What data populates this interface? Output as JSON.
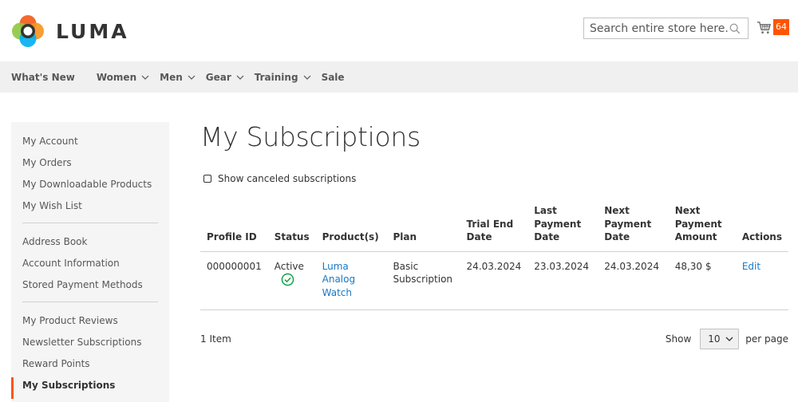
{
  "brand": {
    "name": "LUMA",
    "colors": {
      "accent": "#ff5501",
      "link": "#1979c3",
      "nav_bg": "#f0f0f0"
    }
  },
  "search": {
    "placeholder": "Search entire store here..."
  },
  "cart": {
    "count": "64"
  },
  "nav": {
    "items": [
      {
        "label": "What's New",
        "has_dropdown": false
      },
      {
        "label": "Women",
        "has_dropdown": true
      },
      {
        "label": "Men",
        "has_dropdown": true
      },
      {
        "label": "Gear",
        "has_dropdown": true
      },
      {
        "label": "Training",
        "has_dropdown": true
      },
      {
        "label": "Sale",
        "has_dropdown": false
      }
    ]
  },
  "sidebar": {
    "group1": [
      "My Account",
      "My Orders",
      "My Downloadable Products",
      "My Wish List"
    ],
    "group2": [
      "Address Book",
      "Account Information",
      "Stored Payment Methods"
    ],
    "group3": [
      "My Product Reviews",
      "Newsletter Subscriptions",
      "Reward Points",
      "My Subscriptions"
    ],
    "current": "My Subscriptions"
  },
  "main": {
    "title": "My Subscriptions",
    "show_canceled_label": "Show canceled subscriptions",
    "show_canceled_checked": false
  },
  "table": {
    "headers": {
      "profile_id": "Profile ID",
      "status": "Status",
      "products": "Product(s)",
      "plan": "Plan",
      "trial_end": "Trial End Date",
      "last_payment": "Last Payment Date",
      "next_payment": "Next Payment Date",
      "next_amount": "Next Payment Amount",
      "actions": "Actions"
    },
    "rows": [
      {
        "profile_id": "000000001",
        "status": "Active",
        "product": "Luma Analog Watch",
        "plan": "Basic Subscription",
        "trial_end": "24.03.2024",
        "last_payment": "23.03.2024",
        "next_payment": "24.03.2024",
        "next_amount": "48,30 $",
        "action": "Edit"
      }
    ]
  },
  "pager": {
    "count_text": "1 Item",
    "show_label": "Show",
    "limit_value": "10",
    "per_page_label": "per page"
  }
}
